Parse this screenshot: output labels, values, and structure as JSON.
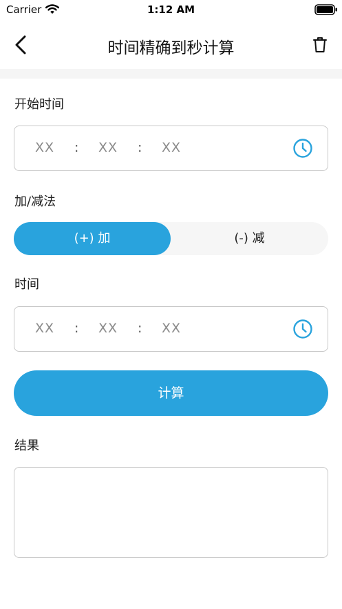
{
  "status_bar": {
    "carrier": "Carrier",
    "time": "1:12 AM"
  },
  "nav": {
    "title": "时间精确到秒计算"
  },
  "start_time": {
    "label": "开始时间",
    "hours": "XX",
    "minutes": "XX",
    "seconds": "XX",
    "separator": ":"
  },
  "operation": {
    "label": "加/减法",
    "options": [
      "(+) 加",
      "(-) 减"
    ],
    "selected": "(+) 加"
  },
  "duration": {
    "label": "时间",
    "hours": "XX",
    "minutes": "XX",
    "seconds": "XX",
    "separator": ":"
  },
  "calculate_button": "计算",
  "result": {
    "label": "结果",
    "value": ""
  },
  "colors": {
    "accent": "#29a3dd",
    "border": "#c8c8c8",
    "band": "#f5f5f5"
  }
}
